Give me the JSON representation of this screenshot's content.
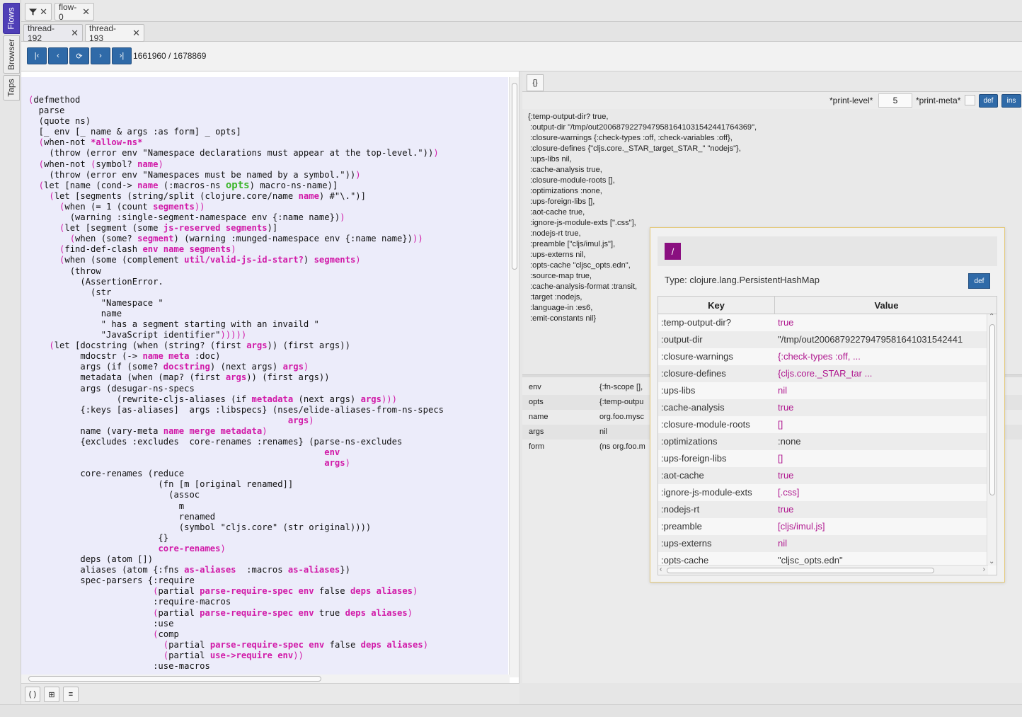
{
  "side_tabs": [
    "Flows",
    "Browser",
    "Taps"
  ],
  "flow_tabs": [
    {
      "label": "flow-0"
    }
  ],
  "thread_tabs": [
    {
      "label": "thread-192"
    },
    {
      "label": "thread-193"
    }
  ],
  "toolbar": {
    "first": "|‹",
    "prev": "‹",
    "reload": "⟳",
    "next": "›",
    "last": "›|",
    "step_counter": "1661960 / 1678869"
  },
  "code_bottom": {
    "forms_btn": "( )",
    "tree_btn": "⊞",
    "list_btn": "≡"
  },
  "right": {
    "tab_label": "{}",
    "print_level_label": "*print-level*",
    "print_level_value": "5",
    "print_meta_label": "*print-meta*",
    "def_label": "def",
    "ins_label": "ins",
    "value_text": "{:temp-output-dir? true,\n :output-dir \"/tmp/out200687922794795816410315424417643​69\",\n :closure-warnings {:check-types :off, :check-variables :off},\n :closure-defines {\"cljs.core._STAR_target_STAR_\" \"nodejs\"},\n :ups-libs nil,\n :cache-analysis true,\n :closure-module-roots [],\n :optimizations :none,\n :ups-foreign-libs [],\n :aot-cache true,\n :ignore-js-module-exts [\".css\"],\n :nodejs-rt true,\n :preamble [\"cljs/imul.js\"],\n :ups-externs nil,\n :opts-cache \"cljsc_opts.edn\",\n :source-map true,\n :cache-analysis-format :transit,\n :target :nodejs,\n :language-in :es6,\n :emit-constants nil}",
    "locals": [
      {
        "name": "env",
        "value": "{:fn-scope [],"
      },
      {
        "name": "opts",
        "value": "{:temp-outpu"
      },
      {
        "name": "name",
        "value": "org.foo.mysc"
      },
      {
        "name": "args",
        "value": "nil"
      },
      {
        "name": "form",
        "value": "(ns org.foo.m"
      }
    ]
  },
  "popup": {
    "slash": "/",
    "type_text": "Type: clojure.lang.PersistentHashMap",
    "def_label": "def",
    "col_key": "Key",
    "col_value": "Value",
    "rows": [
      {
        "k": ":temp-output-dir?",
        "v": "true",
        "mag": true
      },
      {
        "k": ":output-dir",
        "v": "\"/tmp/out20068792279479581641031542441",
        "mag": false
      },
      {
        "k": ":closure-warnings",
        "v": "{:check-types :off,  ...",
        "mag": true
      },
      {
        "k": ":closure-defines",
        "v": "{cljs.core._STAR_tar ...",
        "mag": true
      },
      {
        "k": ":ups-libs",
        "v": "nil",
        "mag": true
      },
      {
        "k": ":cache-analysis",
        "v": "true",
        "mag": true
      },
      {
        "k": ":closure-module-roots",
        "v": "[]",
        "mag": true
      },
      {
        "k": ":optimizations",
        "v": ":none",
        "mag": false
      },
      {
        "k": ":ups-foreign-libs",
        "v": "[]",
        "mag": true
      },
      {
        "k": ":aot-cache",
        "v": "true",
        "mag": true
      },
      {
        "k": ":ignore-js-module-exts",
        "v": "[.css]",
        "mag": true
      },
      {
        "k": ":nodejs-rt",
        "v": "true",
        "mag": true
      },
      {
        "k": ":preamble",
        "v": "[cljs/imul.js]",
        "mag": true
      },
      {
        "k": ":ups-externs",
        "v": "nil",
        "mag": true
      },
      {
        "k": ":opts-cache",
        "v": "\"cljsc_opts.edn\"",
        "mag": false
      }
    ]
  },
  "code_lines": [
    [
      [
        "(",
        "hl2"
      ],
      [
        "defmethod",
        ""
      ]
    ],
    [
      [
        "  parse",
        ""
      ]
    ],
    [
      [
        "  (quote ns)",
        ""
      ]
    ],
    [
      [
        "  [_ env [_ name & args :as form] _ opts]",
        ""
      ]
    ],
    [
      [
        "  (",
        "hl2"
      ],
      [
        "when-not ",
        ""
      ],
      [
        "*allow-ns*",
        "hl"
      ]
    ],
    [
      [
        "    (throw (error env \"Namespace declarations must appear at the top-level.\"))",
        ""
      ],
      [
        ")",
        "hl2"
      ]
    ],
    [
      [
        "  (",
        "hl2"
      ],
      [
        "when-not ",
        ""
      ],
      [
        "(",
        "hl2"
      ],
      [
        "symbol? ",
        ""
      ],
      [
        "name",
        "hl"
      ],
      [
        ")",
        "hl2"
      ]
    ],
    [
      [
        "    (throw (error env \"Namespaces must be named by a symbol.\"))",
        ""
      ],
      [
        ")",
        "hl2"
      ]
    ],
    [
      [
        "  (",
        "hl2"
      ],
      [
        "let [name (cond-> ",
        ""
      ],
      [
        "name",
        "hl"
      ],
      [
        " (:macros-ns ",
        ""
      ],
      [
        "opts",
        "gr"
      ],
      [
        ") macro-ns-name)]",
        ""
      ]
    ],
    [
      [
        "    (",
        "hl2"
      ],
      [
        "let [segments (string/split (clojure.core/name ",
        ""
      ],
      [
        "name",
        "hl"
      ],
      [
        ") #\"\\.\")]",
        ""
      ]
    ],
    [
      [
        "      (",
        "hl2"
      ],
      [
        "when (= 1 (count ",
        ""
      ],
      [
        "segments",
        "hl"
      ],
      [
        "))",
        "hl2"
      ]
    ],
    [
      [
        "        (warning :single-segment-namespace env {:name name})",
        ""
      ],
      [
        ")",
        "hl2"
      ]
    ],
    [
      [
        "      (",
        "hl2"
      ],
      [
        "let [segment (some ",
        ""
      ],
      [
        "js-reserved segments",
        "hl"
      ],
      [
        ")]",
        ""
      ]
    ],
    [
      [
        "        (",
        "hl2"
      ],
      [
        "when (some? ",
        ""
      ],
      [
        "segment",
        "hl"
      ],
      [
        ") (warning :munged-namespace env {:name name})",
        ""
      ],
      [
        "))",
        "hl2"
      ]
    ],
    [
      [
        "      (",
        "hl2"
      ],
      [
        "find-def-clash ",
        ""
      ],
      [
        "env name segments",
        "hl"
      ],
      [
        ")",
        "hl2"
      ]
    ],
    [
      [
        "      (",
        "hl2"
      ],
      [
        "when (some (complement ",
        ""
      ],
      [
        "util/valid-js-id-start?",
        "hl"
      ],
      [
        ") ",
        ""
      ],
      [
        "segments",
        "hl"
      ],
      [
        ")",
        "hl2"
      ]
    ],
    [
      [
        "        (throw",
        ""
      ]
    ],
    [
      [
        "          (AssertionError.",
        ""
      ]
    ],
    [
      [
        "            (str",
        ""
      ]
    ],
    [
      [
        "              \"Namespace \"",
        ""
      ]
    ],
    [
      [
        "              name",
        ""
      ]
    ],
    [
      [
        "              \" has a segment starting with an invaild \"",
        ""
      ]
    ],
    [
      [
        "              \"JavaScript identifier\"",
        ""
      ],
      [
        ")))))",
        "hl2"
      ]
    ],
    [
      [
        "    (",
        "hl2"
      ],
      [
        "let [docstring (when (string? (",
        ""
      ],
      [
        "first ",
        ""
      ],
      [
        "args",
        "hl"
      ],
      [
        ")) (first args))",
        ""
      ]
    ],
    [
      [
        "          mdocstr (",
        ""
      ],
      [
        "-> ",
        ""
      ],
      [
        "name meta",
        "hl"
      ],
      [
        " :doc)",
        ""
      ]
    ],
    [
      [
        "          args (if (some? ",
        ""
      ],
      [
        "docstring",
        "hl"
      ],
      [
        ") (next args) ",
        ""
      ],
      [
        "args",
        "hl"
      ],
      [
        ")",
        "hl2"
      ]
    ],
    [
      [
        "          metadata (when (map? (first ",
        ""
      ],
      [
        "args",
        "hl"
      ],
      [
        ")) (first args))",
        ""
      ]
    ],
    [
      [
        "          args (desugar-ns-specs",
        ""
      ]
    ],
    [
      [
        "                 (rewrite-cljs-aliases (if ",
        ""
      ],
      [
        "metadata",
        "hl"
      ],
      [
        " (next args) ",
        ""
      ],
      [
        "args",
        "hl"
      ],
      [
        ")))",
        "hl2"
      ]
    ],
    [
      [
        "          {:keys [as-aliases]  args :libspecs} (nses/elide-aliases-from-ns-specs",
        ""
      ]
    ],
    [
      [
        "                                                  ",
        ""
      ],
      [
        "args",
        "hl"
      ],
      [
        ")",
        "hl2"
      ]
    ],
    [
      [
        "          name (vary-meta ",
        ""
      ],
      [
        "name merge metadata",
        "hl"
      ],
      [
        ")",
        "hl2"
      ]
    ],
    [
      [
        "          {excludes :excludes  core-renames :renames} (parse-ns-excludes",
        ""
      ]
    ],
    [
      [
        "                                                         ",
        ""
      ],
      [
        "env",
        "hl"
      ]
    ],
    [
      [
        "                                                         ",
        ""
      ],
      [
        "args",
        "hl"
      ],
      [
        ")",
        "hl2"
      ]
    ],
    [
      [
        "          core-renames (reduce",
        ""
      ]
    ],
    [
      [
        "                         (fn [m [original renamed]]",
        ""
      ]
    ],
    [
      [
        "                           (assoc",
        ""
      ]
    ],
    [
      [
        "                             m",
        ""
      ]
    ],
    [
      [
        "                             renamed",
        ""
      ]
    ],
    [
      [
        "                             (symbol \"cljs.core\" (str original))))",
        ""
      ]
    ],
    [
      [
        "                         {}",
        ""
      ]
    ],
    [
      [
        "                         ",
        ""
      ],
      [
        "core-renames",
        "hl"
      ],
      [
        ")",
        "hl2"
      ]
    ],
    [
      [
        "          deps (atom [])",
        ""
      ]
    ],
    [
      [
        "          aliases (atom {:fns ",
        ""
      ],
      [
        "as-aliases",
        "hl"
      ],
      [
        "  :macros ",
        ""
      ],
      [
        "as-aliases",
        "hl"
      ],
      [
        "})",
        ""
      ]
    ],
    [
      [
        "          spec-parsers {:require",
        ""
      ]
    ],
    [
      [
        "                        (",
        "hl2"
      ],
      [
        "partial ",
        ""
      ],
      [
        "parse-require-spec env",
        "hl"
      ],
      [
        " false ",
        ""
      ],
      [
        "deps aliases",
        "hl"
      ],
      [
        ")",
        "hl2"
      ]
    ],
    [
      [
        "                        :require-macros",
        ""
      ]
    ],
    [
      [
        "                        (",
        "hl2"
      ],
      [
        "partial ",
        ""
      ],
      [
        "parse-require-spec env",
        "hl"
      ],
      [
        " true ",
        ""
      ],
      [
        "deps aliases",
        "hl"
      ],
      [
        ")",
        "hl2"
      ]
    ],
    [
      [
        "                        :use",
        ""
      ]
    ],
    [
      [
        "                        (",
        "hl2"
      ],
      [
        "comp",
        ""
      ]
    ],
    [
      [
        "                          (",
        "hl2"
      ],
      [
        "partial ",
        ""
      ],
      [
        "parse-require-spec env",
        "hl"
      ],
      [
        " false ",
        ""
      ],
      [
        "deps aliases",
        "hl"
      ],
      [
        ")",
        "hl2"
      ]
    ],
    [
      [
        "                          (",
        "hl2"
      ],
      [
        "partial ",
        ""
      ],
      [
        "use->require env",
        "hl"
      ],
      [
        "))",
        "hl2"
      ]
    ],
    [
      [
        "                        :use-macros",
        ""
      ]
    ]
  ]
}
